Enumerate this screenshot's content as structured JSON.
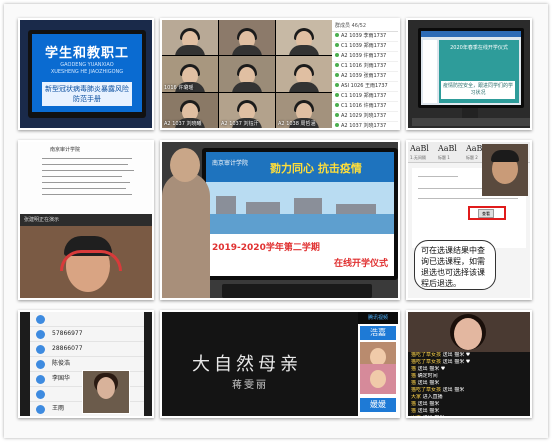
{
  "tile1": {
    "title": "学生和教职工",
    "pinyin_1": "GAODENG YUANXIAO",
    "pinyin_2": "XUESHENG HE JIAOZHIGONG",
    "subtitle": "新型冠状病毒肺炎暴露风险防范手册"
  },
  "tile2": {
    "roster_header": "群成员 46/52",
    "captions": [
      "",
      "",
      "",
      "1016 许璐瑶",
      "",
      "",
      "A2 1037 刘晓曦",
      "A2 1037 刘钰汗",
      "A2 1038 周哲涵"
    ],
    "roster": [
      "A2 1039 李雨1737",
      "C1 1039 郑雨1737",
      "A2 1039 许雨1737",
      "C1 1016 刘雨1737",
      "A2 1039 张雨1737",
      "ASI 1026 王雨1737",
      "C1 1019 郑雨1737",
      "C1 1016 许雨1737",
      "A2 1029 刘晓1737",
      "A2 1037 刘晓1737",
      "A2 1038 王雨1737"
    ]
  },
  "tile3": {
    "slide_title": "2020年春季在线开学仪式",
    "slide_box": "疫情防控安全，跟进同学们的学习状况"
  },
  "tile4": {
    "doc_title": "南京审计学院",
    "presenter": "张建明正在演示"
  },
  "tile5": {
    "school": "南京审计学院",
    "slogan": "勠力同心  抗击疫情",
    "title_1": "2019-2020学年第二学期",
    "title_2": "在线开学仪式"
  },
  "tile6": {
    "styles": [
      {
        "sample": "AaBl",
        "label": "1.无间隔"
      },
      {
        "sample": "AaBl",
        "label": "标题 1"
      },
      {
        "sample": "AaBbC",
        "label": "标题 2"
      },
      {
        "sample": "AaB",
        "label": "标题"
      }
    ],
    "button_label": "查看",
    "popup_text": "可在选课结果中查询已选课程，如需退选也可选择该课程后退选。"
  },
  "tile7": {
    "contacts": [
      "",
      "57866977",
      "28866077",
      "陈俊浩",
      "李国华",
      "",
      "王雨"
    ]
  },
  "tile8": {
    "title": "大自然母亲",
    "author": "蒋雯丽",
    "logo": "腾讯视频",
    "names": [
      "浩嘉",
      "媛媛"
    ]
  },
  "tile9": {
    "messages": [
      {
        "who": "猫吃了草女孩",
        "text": "送出 猫米 ♥"
      },
      {
        "who": "猫吃了草女孩",
        "text": "送出 猫米 ♥"
      },
      {
        "who": "猫",
        "text": "送出 猫米 ♥"
      },
      {
        "who": "猫",
        "text": "确定时间"
      },
      {
        "who": "猫",
        "text": "送出 猫米"
      },
      {
        "who": "猫吃了草女孩",
        "text": "送出 猫米"
      },
      {
        "who": "大家",
        "text": "进入直播"
      },
      {
        "who": "猫",
        "text": "送出 猫米"
      },
      {
        "who": "猫",
        "text": "送出 猫米"
      },
      {
        "who": "山美",
        "text": "送出 猫米"
      },
      {
        "who": "山美",
        "text": "送出 猫米 ♥"
      }
    ]
  },
  "colors": {
    "tile1_blue": "#0a6bd1",
    "tile5_red": "#e03030",
    "tile5_header": "#1e73be",
    "tile6_redbox": "#e01b1b",
    "tile8_name": "#1e7ad6"
  }
}
